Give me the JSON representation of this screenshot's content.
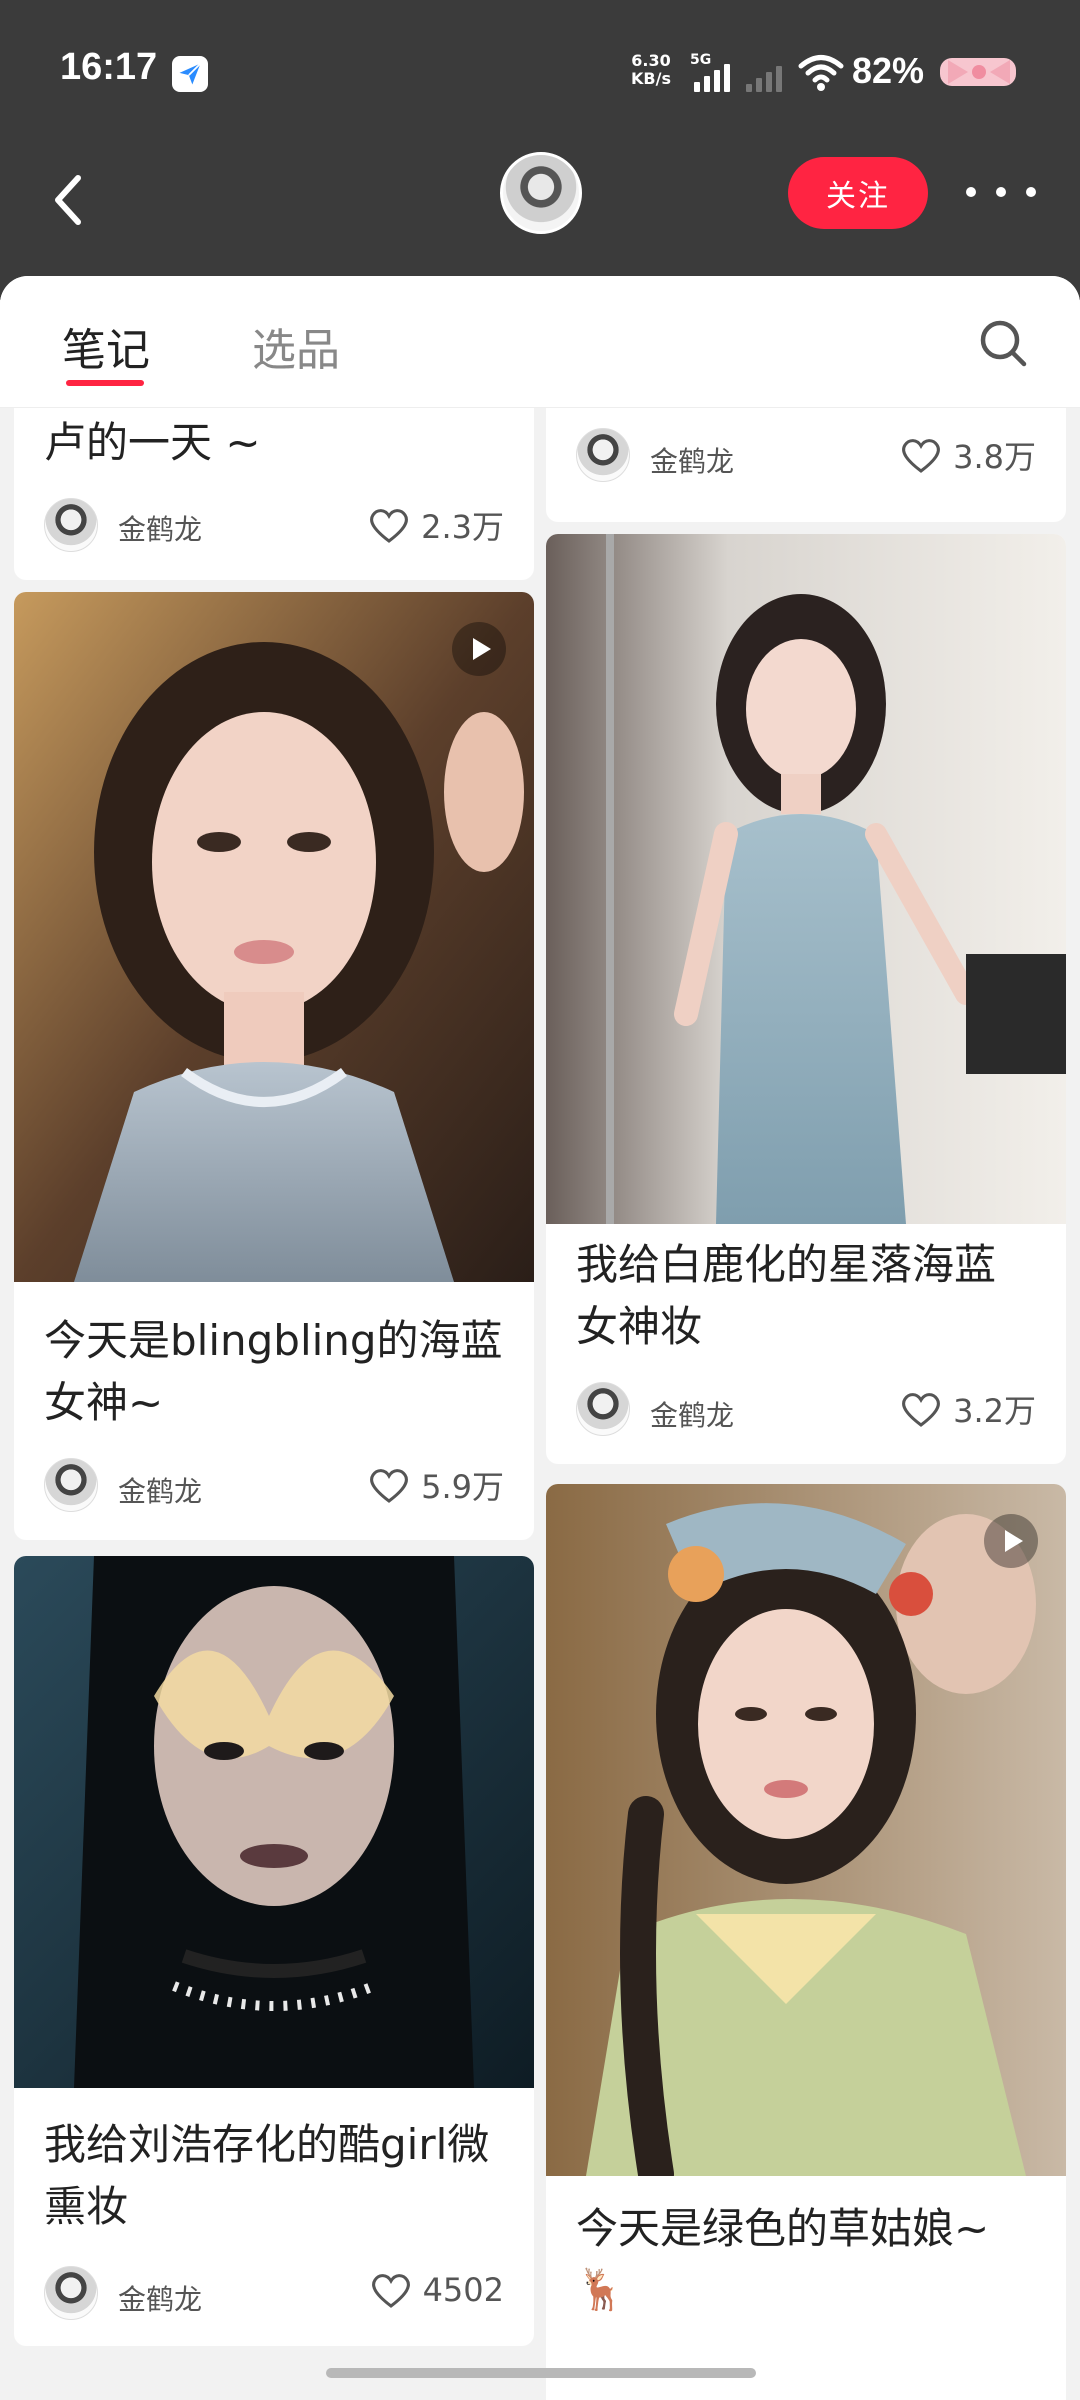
{
  "status_bar": {
    "time": "16:17",
    "net_speed_value": "6.30",
    "net_speed_unit": "KB/s",
    "network_type": "5G",
    "battery": "82%"
  },
  "nav": {
    "follow_label": "关注"
  },
  "tabs": [
    {
      "label": "笔记",
      "active": true
    },
    {
      "label": "选品",
      "active": false
    }
  ],
  "cards": [
    {
      "title": "卢的一天 ~",
      "author": "金鹤龙",
      "likes": "2.3万",
      "video": false
    },
    {
      "title": "",
      "author": "金鹤龙",
      "likes": "3.8万",
      "video": false
    },
    {
      "title": "今天是blingbling的海蓝女神~",
      "author": "金鹤龙",
      "likes": "5.9万",
      "video": true
    },
    {
      "title": "我给白鹿化的星落海蓝女神妆",
      "author": "金鹤龙",
      "likes": "3.2万",
      "video": false
    },
    {
      "title": "我给刘浩存化的酷girl微熏妆",
      "author": "金鹤龙",
      "likes": "4502",
      "video": false
    },
    {
      "title": "今天是绿色的草姑娘~",
      "author": "",
      "likes": "",
      "video": true,
      "emoji": "🦌"
    }
  ],
  "colors": {
    "accent": "#ff2442",
    "header_bg": "#3b3b3b"
  }
}
